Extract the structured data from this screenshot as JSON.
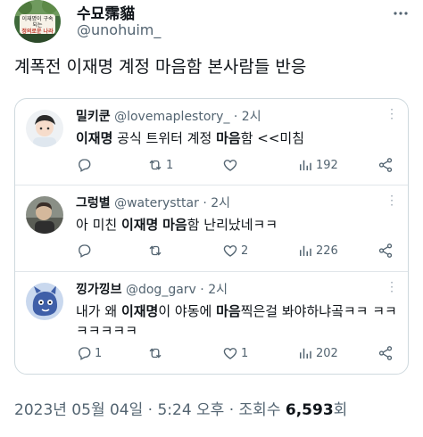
{
  "author": {
    "display_name": "수묘霈貓",
    "handle": "@unohuim_",
    "avatar_sign_line1": "이재명이 구속되는",
    "avatar_sign_line2": "정의로운 나라"
  },
  "tweet_text": "계폭전 이재명 계정  마음함 본사람들 반응",
  "replies": [
    {
      "name": "밀키쿤",
      "handle": "@lovemaplestory_",
      "time": "· 2시",
      "body_pre": "",
      "body_b1": "이재명",
      "body_mid": " 공식 트위터 계정 ",
      "body_b2": "마음",
      "body_post": "함 <<미침",
      "reply_count": "",
      "retweet_count": "1",
      "like_count": "",
      "view_count": "192"
    },
    {
      "name": "그렁별",
      "handle": "@waterysttar",
      "time": "· 2시",
      "body_pre": "아 미친 ",
      "body_b1": "이재명",
      "body_mid": " ",
      "body_b2": "마음",
      "body_post": "함 난리났네ㅋㅋ",
      "reply_count": "",
      "retweet_count": "",
      "like_count": "2",
      "view_count": "226"
    },
    {
      "name": "낑가낑브",
      "handle": "@dog_garv",
      "time": "· 2시",
      "body_pre": "내가 왜 ",
      "body_b1": "이재명",
      "body_mid": "이 야동에 ",
      "body_b2": "마음",
      "body_post": "찍은걸 봐야하냐곸ㅋㅋ ㅋㅋㅋㅋㅋㅋㅋ",
      "reply_count": "1",
      "retweet_count": "",
      "like_count": "1",
      "view_count": "202"
    }
  ],
  "footer": {
    "timestamp": "2023년 05월 04일 · 5:24 오후 · 조회수 ",
    "views": "6,593",
    "views_suffix": "회"
  },
  "icons": {
    "reply": "reply-icon",
    "retweet": "retweet-icon",
    "like": "heart-icon",
    "views": "analytics-icon",
    "share": "share-icon",
    "more": "more-icon"
  },
  "colors": {
    "secondary_text": "#536471",
    "border": "#cfd9de"
  }
}
